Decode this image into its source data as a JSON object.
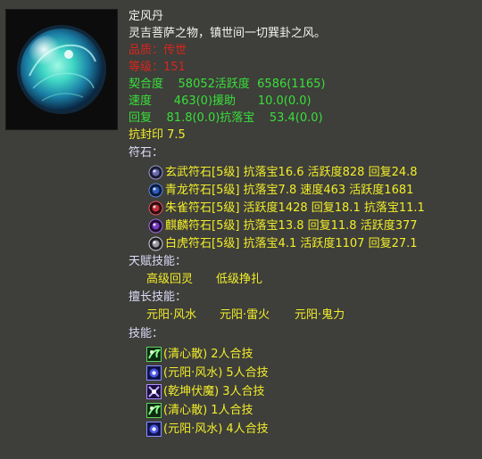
{
  "item": {
    "name": "定风丹",
    "desc": "灵吉菩萨之物，镇世间一切巽卦之风。",
    "quality": "品质：传世",
    "level": "等级：151",
    "icon": "wind-orb-icon"
  },
  "stats": {
    "line1": "契合度    58052活跃度  6586(1165)",
    "line2": "速度      463(0)援助      10.0(0.0)",
    "line3": "回复    81.8(0.0)抗落宝    53.4(0.0)",
    "line4": "抗封印 7.5"
  },
  "runes": {
    "heading": "符石：",
    "items": [
      {
        "text": "玄武符石[5级] 抗落宝16.6 活跃度828 回复24.8",
        "icon": "xuanwu-rune-icon",
        "color": "#6a6ab0"
      },
      {
        "text": "青龙符石[5级] 抗落宝7.8 速度463 活跃度1681",
        "icon": "qinglong-rune-icon",
        "color": "#2f5cc0"
      },
      {
        "text": "朱雀符石[5级] 活跃度1428 回复18.1 抗落宝11.1",
        "icon": "zhuque-rune-icon",
        "color": "#c0303a"
      },
      {
        "text": "麒麟符石[5级] 抗落宝13.8 回复11.8 活跃度377",
        "icon": "qilin-rune-icon",
        "color": "#7a3cc0"
      },
      {
        "text": "白虎符石[5级] 抗落宝4.1 活跃度1107 回复27.1",
        "icon": "baihu-rune-icon",
        "color": "#9a9aa6"
      }
    ]
  },
  "talent": {
    "heading": "天赋技能：",
    "skills": [
      "高级回灵",
      "低级挣扎"
    ]
  },
  "specialty": {
    "heading": "擅长技能：",
    "skills": [
      "元阳·风水",
      "元阳·雷火",
      "元阳·鬼力"
    ]
  },
  "skills": {
    "heading": "技能：",
    "items": [
      {
        "text": "(清心散) 2人合技",
        "icon": "qingxinsan-skill-icon",
        "type": "green"
      },
      {
        "text": "(元阳·风水) 5人合技",
        "icon": "yuanyang-fengshui-skill-icon",
        "type": "blue"
      },
      {
        "text": "(乾坤伏魔) 3人合技",
        "icon": "qiankun-fumo-skill-icon",
        "type": "blue"
      },
      {
        "text": "(清心散) 1人合技",
        "icon": "qingxinsan-skill-icon",
        "type": "green"
      },
      {
        "text": "(元阳·风水) 4人合技",
        "icon": "yuanyang-fengshui-skill-icon",
        "type": "blue"
      }
    ]
  }
}
